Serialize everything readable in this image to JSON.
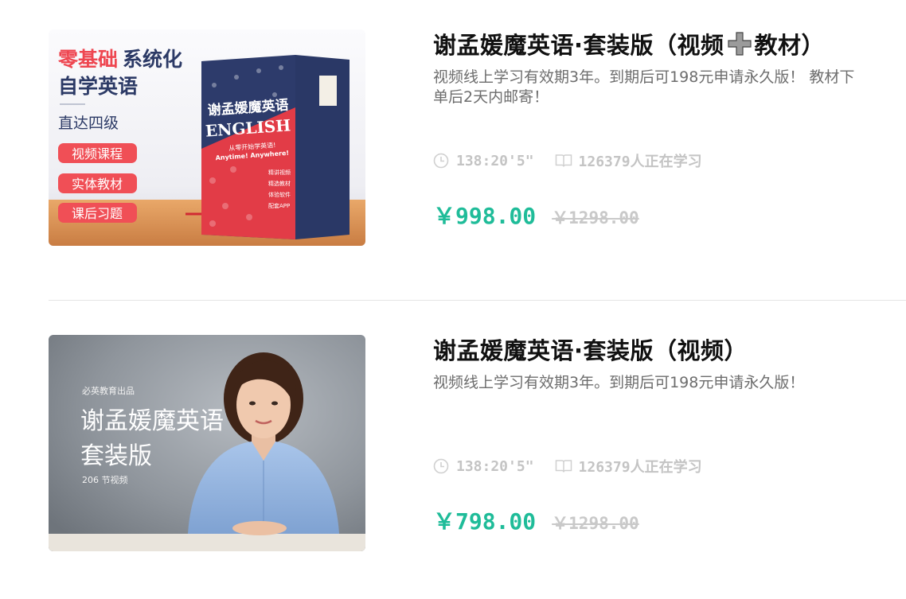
{
  "courses": [
    {
      "title_part1": "谢孟媛魔英语·套装版（视频",
      "title_part2": "教材）",
      "description": "视频线上学习有效期3年。到期后可198元申请永久版！ 教材下单后2天内邮寄！",
      "duration": "138:20'5\"",
      "learners": "126379人正在学习",
      "price": "￥998.00",
      "original_price": "￥1298.00",
      "cover": {
        "headline_red": "零基础",
        "headline_blue": "系统化",
        "headline_line2": "自学英语",
        "subhead": "直达四级",
        "tags": [
          "视频课程",
          "实体教材",
          "课后习题"
        ],
        "box_title_cn": "谢孟媛魔英语",
        "box_title_en": "ENGLISH",
        "box_slogan": "从零开始学英语!",
        "box_slogan_en": "Anytime! Anywhere!",
        "box_features": [
          "精讲视频",
          "精选教材",
          "体验软件",
          "配套APP"
        ]
      }
    },
    {
      "title_part1": "谢孟媛魔英语·套装版（视频）",
      "title_part2": "",
      "description": "视频线上学习有效期3年。到期后可198元申请永久版！",
      "duration": "138:20'5\"",
      "learners": "126379人正在学习",
      "price": "￥798.00",
      "original_price": "￥1298.00",
      "cover": {
        "publisher": "必英教育出品",
        "title_line1": "谢孟媛魔英语",
        "title_line2": "套装版",
        "count": "206 节视频"
      }
    }
  ],
  "colors": {
    "price": "#1fbc99",
    "meta": "#c4c4c4",
    "tag_red": "#f04f56",
    "navy": "#2c3a66"
  },
  "icons": {
    "clock": "clock-icon",
    "book": "book-icon",
    "plus": "plus-icon"
  }
}
